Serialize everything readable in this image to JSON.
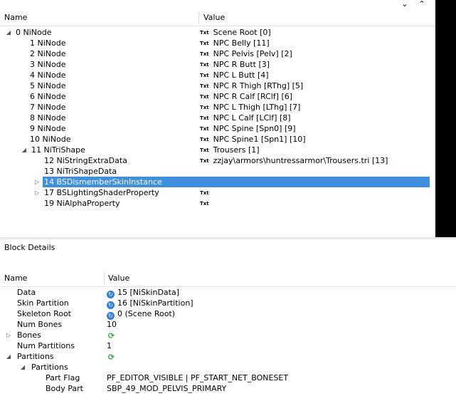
{
  "tree": {
    "header": {
      "name": "Name",
      "value": "Value"
    },
    "rows": [
      {
        "name": "0 NiNode",
        "value": "Scene Root [0]",
        "txt": true
      },
      {
        "name": "1 NiNode",
        "value": "NPC Belly [11]",
        "txt": true
      },
      {
        "name": "2 NiNode",
        "value": "NPC Pelvis [Pelv] [2]",
        "txt": true
      },
      {
        "name": "3 NiNode",
        "value": "NPC R Butt [3]",
        "txt": true
      },
      {
        "name": "4 NiNode",
        "value": "NPC L Butt [4]",
        "txt": true
      },
      {
        "name": "5 NiNode",
        "value": "NPC R Thigh [RThg] [5]",
        "txt": true
      },
      {
        "name": "6 NiNode",
        "value": "NPC R Calf [RClf] [6]",
        "txt": true
      },
      {
        "name": "7 NiNode",
        "value": "NPC L Thigh [LThg] [7]",
        "txt": true
      },
      {
        "name": "8 NiNode",
        "value": "NPC L Calf [LClf] [8]",
        "txt": true
      },
      {
        "name": "9 NiNode",
        "value": "NPC Spine [Spn0] [9]",
        "txt": true
      },
      {
        "name": "10 NiNode",
        "value": "NPC Spine1 [Spn1] [10]",
        "txt": true
      },
      {
        "name": "11 NiTriShape",
        "value": "Trousers [1]",
        "txt": true
      },
      {
        "name": "12 NiStringExtraData",
        "value": "zzjay\\armors\\huntressarmor\\Trousers.tri [13]",
        "txt": true
      },
      {
        "name": "13 NiTriShapeData",
        "value": "",
        "txt": false
      },
      {
        "name": "14 BSDismemberSkinInstance",
        "value": "",
        "txt": false
      },
      {
        "name": "17 BSLightingShaderProperty",
        "value": "",
        "txt": true
      },
      {
        "name": "19 NiAlphaProperty",
        "value": "",
        "txt": true
      }
    ],
    "txt_badge": "Txt",
    "expand_collapsed": "▷",
    "expand_open": "◢"
  },
  "viewport": {
    "collapse_icon": "⌄",
    "expand_icon": "⌃"
  },
  "block_details": {
    "title": "Block Details",
    "header": {
      "name": "Name",
      "value": "Value"
    },
    "rows": [
      {
        "name": "Data",
        "value": "15 [NiSkinData]",
        "icon": "link"
      },
      {
        "name": "Skin Partition",
        "value": "16 [NiSkinPartition]",
        "icon": "link"
      },
      {
        "name": "Skeleton Root",
        "value": "0 (Scene Root)",
        "icon": "link"
      },
      {
        "name": "Num Bones",
        "value": "10",
        "icon": ""
      },
      {
        "name": "Bones",
        "value": "",
        "icon": "array"
      },
      {
        "name": "Num Partitions",
        "value": "1",
        "icon": ""
      },
      {
        "name": "Partitions",
        "value": "",
        "icon": "array"
      },
      {
        "name": "Partitions",
        "value": "",
        "icon": ""
      },
      {
        "name": "Part Flag",
        "value": "PF_EDITOR_VISIBLE | PF_START_NET_BONESET",
        "icon": ""
      },
      {
        "name": "Body Part",
        "value": "SBP_49_MOD_PELVIS_PRIMARY",
        "icon": ""
      }
    ]
  },
  "colors": {
    "selection": "#3f8fe0",
    "link_icon": "#2f7fd8",
    "array_icon": "#2ea03a"
  }
}
